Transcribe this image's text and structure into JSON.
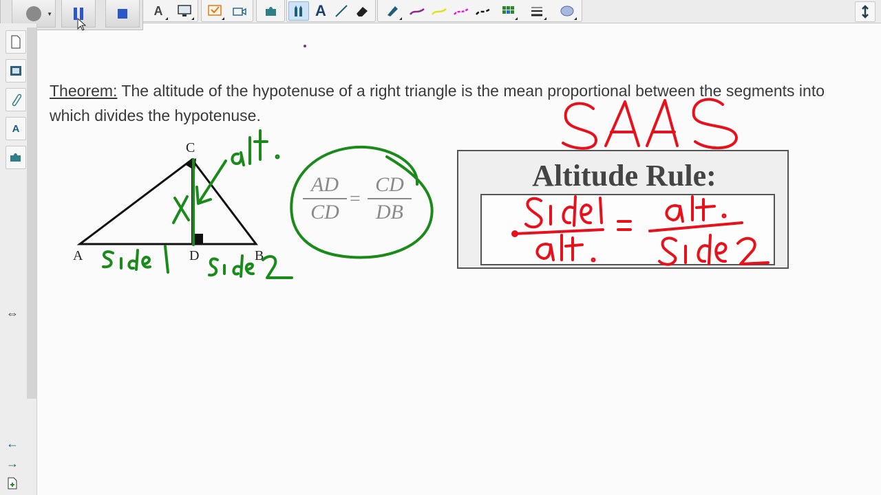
{
  "toolbar": {
    "tools": [
      "page-icon",
      "select-icon",
      "screen-capture-icon",
      "text-tool-icon",
      "display-icon",
      "checkmark-icon",
      "camera-icon",
      "shape-icon",
      "pen-icon",
      "text-icon",
      "line-icon",
      "eraser-icon",
      "highlighter-icon",
      "purple-pen-icon",
      "yellow-pen-icon",
      "magenta-pen-icon",
      "black-pen-icon",
      "table-icon",
      "line-style-icon",
      "fill-icon"
    ],
    "text_tool_glyph": "A"
  },
  "recorder": {
    "buttons": [
      "record-button",
      "pause-button",
      "stop-button"
    ]
  },
  "sidebar": {
    "tabs": [
      "page-sorter-tab",
      "gallery-tab",
      "attachments-tab",
      "properties-tab",
      "addons-tab"
    ],
    "nav": [
      "move-sidebar-icon",
      "previous-page-icon",
      "next-page-icon",
      "add-page-icon"
    ]
  },
  "theorem": {
    "label": "Theorem:",
    "text": " The altitude of the hypotenuse of a right triangle is the mean proportional between the segments into which divides the hypotenuse."
  },
  "triangle": {
    "labels": {
      "a": "A",
      "b": "B",
      "c": "C",
      "d": "D"
    }
  },
  "proportion": {
    "left_num": "AD",
    "left_den": "CD",
    "equals": "=",
    "right_num": "CD",
    "right_den": "DB"
  },
  "altitude_rule": {
    "title": "Altitude Rule:"
  },
  "handwriting": {
    "saas": "SAAS",
    "alt": "alt.",
    "x": "x",
    "side1": "side 1",
    "side2": "side 2",
    "rule_left_num": "side1",
    "rule_left_den": "alt.",
    "rule_equals": "=",
    "rule_right_num": "alt.",
    "rule_right_den": "side2"
  },
  "colors": {
    "green_ink": "#1a8a1a",
    "red_ink": "#e8101a",
    "purple_dot": "#8b2a8b"
  }
}
